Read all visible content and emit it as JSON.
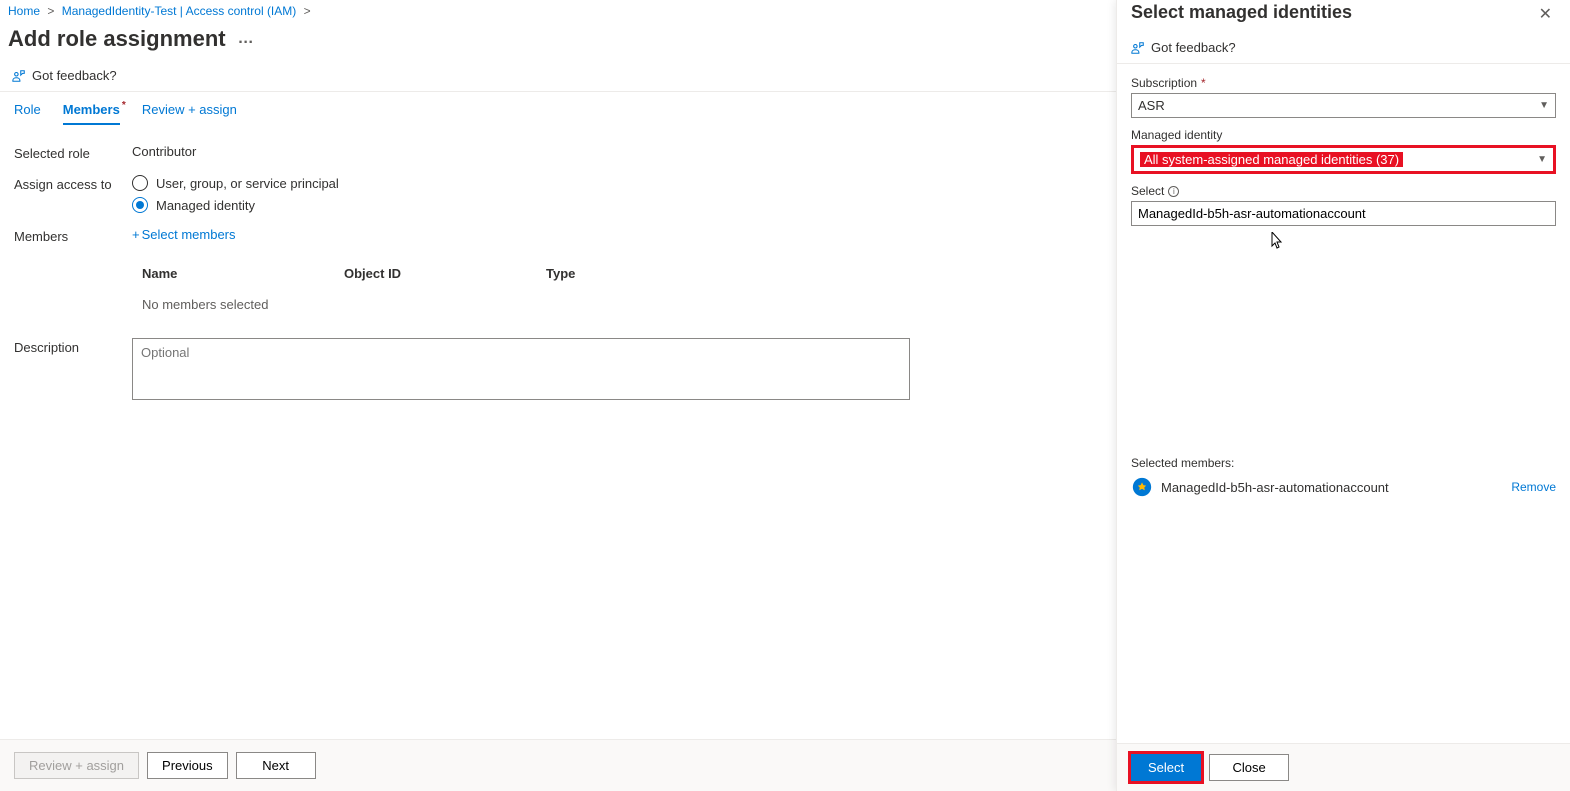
{
  "breadcrumb": {
    "home": "Home",
    "item1": "ManagedIdentity-Test | Access control (IAM)"
  },
  "page": {
    "title": "Add role assignment",
    "feedback": "Got feedback?"
  },
  "tabs": {
    "role": "Role",
    "members": "Members",
    "review": "Review + assign"
  },
  "form": {
    "selected_role_label": "Selected role",
    "selected_role_value": "Contributor",
    "assign_access_label": "Assign access to",
    "radio_user": "User, group, or service principal",
    "radio_managed": "Managed identity",
    "members_label": "Members",
    "select_members": "Select members",
    "table": {
      "col_name": "Name",
      "col_object": "Object ID",
      "col_type": "Type",
      "empty": "No members selected"
    },
    "description_label": "Description",
    "description_placeholder": "Optional"
  },
  "footer": {
    "review": "Review + assign",
    "previous": "Previous",
    "next": "Next"
  },
  "panel": {
    "title": "Select managed identities",
    "feedback": "Got feedback?",
    "subscription_label": "Subscription",
    "subscription_value": "ASR",
    "managed_identity_label": "Managed identity",
    "managed_identity_value": "All system-assigned managed identities (37)",
    "select_label": "Select",
    "select_value": "ManagedId-b5h-asr-automationaccount",
    "selected_members_label": "Selected members:",
    "selected_member_name": "ManagedId-b5h-asr-automationaccount",
    "remove": "Remove",
    "btn_select": "Select",
    "btn_close": "Close"
  }
}
